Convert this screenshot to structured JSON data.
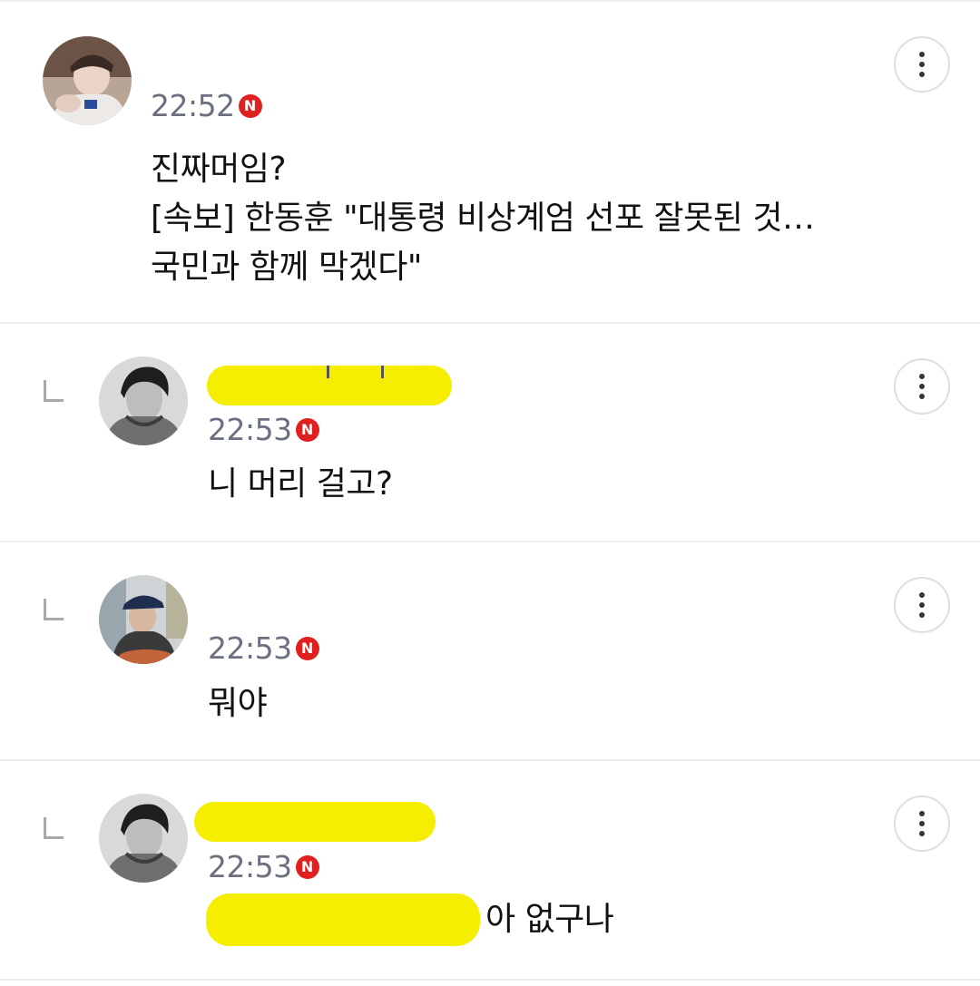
{
  "comments": [
    {
      "time": "22:52",
      "badge": "N",
      "lines": [
        "진짜머임?",
        "[속보] 한동훈 \"대통령 비상계엄 선포 잘못된 것…",
        "국민과 함께 막겠다\""
      ]
    },
    {
      "time": "22:53",
      "badge": "N",
      "text": "니 머리 걸고?"
    },
    {
      "time": "22:53",
      "badge": "N",
      "text": "뭐야"
    },
    {
      "time": "22:53",
      "badge": "N",
      "text": "아 없구나"
    }
  ],
  "icons": {
    "more": "more-vertical-icon",
    "reply": "reply-arrow-icon",
    "new_badge": "new-badge-icon"
  },
  "colors": {
    "badge_red": "#e0201f",
    "redaction_yellow": "#f6ee00",
    "time_gray": "#6b7080"
  }
}
